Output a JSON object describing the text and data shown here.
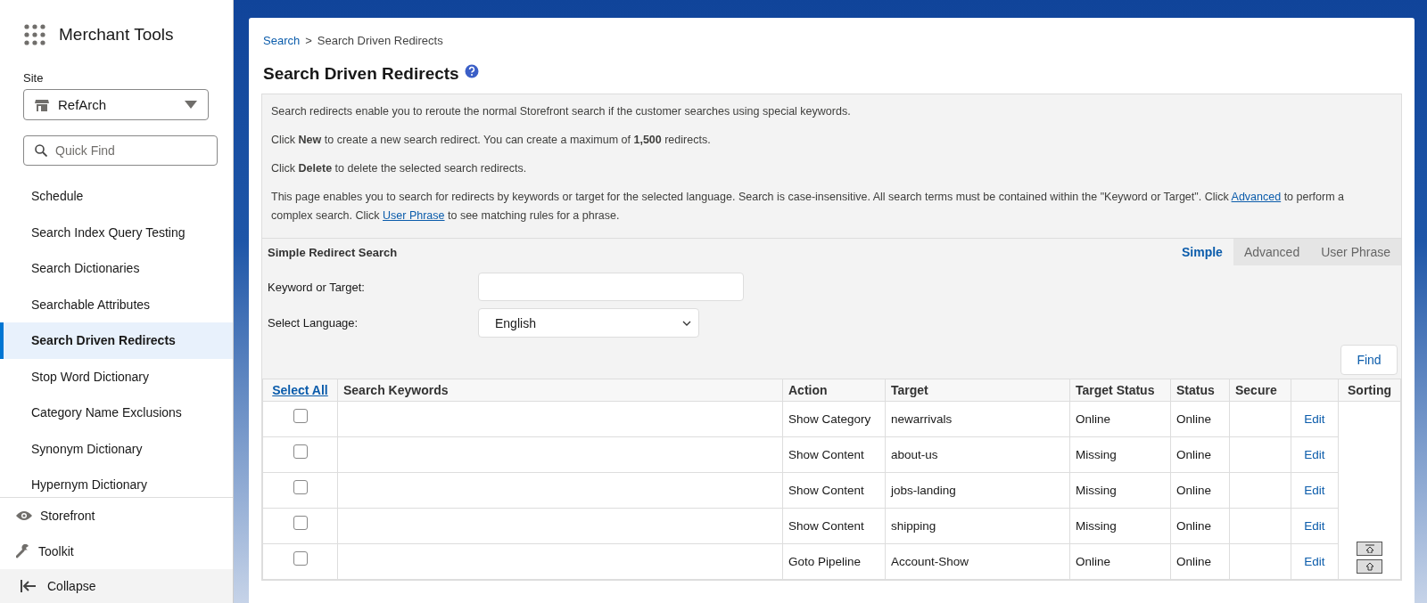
{
  "sidebar": {
    "app_title": "Merchant Tools",
    "site_label": "Site",
    "site_select": {
      "value": "RefArch"
    },
    "quick_find": {
      "placeholder": "Quick Find"
    },
    "items": [
      {
        "label": "Schedule",
        "selected": false
      },
      {
        "label": "Search Index Query Testing",
        "selected": false
      },
      {
        "label": "Search Dictionaries",
        "selected": false
      },
      {
        "label": "Searchable Attributes",
        "selected": false
      },
      {
        "label": "Search Driven Redirects",
        "selected": true
      },
      {
        "label": "Stop Word Dictionary",
        "selected": false
      },
      {
        "label": "Category Name Exclusions",
        "selected": false
      },
      {
        "label": "Synonym Dictionary",
        "selected": false
      },
      {
        "label": "Hypernym Dictionary",
        "selected": false
      }
    ],
    "footer_items": [
      {
        "label": "Storefront",
        "kind": "eye"
      },
      {
        "label": "Toolkit",
        "kind": "wrench"
      },
      {
        "label": "Collapse",
        "kind": "collapse"
      }
    ]
  },
  "breadcrumb": {
    "separator": ">",
    "items": [
      {
        "label": "Search",
        "kind": "link"
      },
      {
        "label": "Search Driven Redirects",
        "kind": "current"
      }
    ]
  },
  "title": "Search Driven Redirects",
  "info": [
    [
      {
        "kind": "text",
        "text": "Search redirects enable you to reroute the normal Storefront search if the customer searches using special keywords."
      }
    ],
    [
      {
        "kind": "text",
        "text": "Click **New** to create a new search redirect. You can create a maximum of **1,500** redirects."
      }
    ],
    [
      {
        "kind": "text",
        "text": "Click **Delete** to delete the selected search redirects."
      }
    ],
    [
      {
        "kind": "text",
        "text": "This page enables you to search for redirects by keywords or target for the selected language. Search is case-insensitive. All search terms must be contained within the \"Keyword or Target\". Click "
      },
      {
        "kind": "link",
        "text": "Advanced"
      },
      {
        "kind": "text",
        "text": " to perform a complex search. Click "
      },
      {
        "kind": "link",
        "text": "User Phrase"
      },
      {
        "kind": "text",
        "text": " to see matching rules for a phrase."
      }
    ]
  ],
  "search": {
    "title": "Simple Redirect Search",
    "tabs": [
      {
        "label": "Simple",
        "selected": true
      },
      {
        "label": "Advanced",
        "selected": false
      },
      {
        "label": "User Phrase",
        "selected": false
      }
    ],
    "fields": [
      {
        "label": "Keyword or Target:",
        "kind": "text"
      },
      {
        "label": "Select Language:",
        "kind": "select",
        "value": "English"
      }
    ],
    "find_button": "Find"
  },
  "table": {
    "columns": [
      {
        "label": "Select All",
        "kind": "link"
      },
      {
        "label": "Search Keywords",
        "kind": "text"
      },
      {
        "label": "Action",
        "kind": "text"
      },
      {
        "label": "Target",
        "kind": "text"
      },
      {
        "label": "Target Status",
        "kind": "text"
      },
      {
        "label": "Status",
        "kind": "text"
      },
      {
        "label": "Secure",
        "kind": "text"
      },
      {
        "kind": "blank"
      },
      {
        "label": "Sorting",
        "kind": "text"
      }
    ],
    "rows": [
      {
        "checked": false,
        "action": "Show Category",
        "target": "newarrivals",
        "target_status": "Online",
        "status": "Online",
        "edit": "Edit"
      },
      {
        "checked": false,
        "action": "Show Content",
        "target": "about-us",
        "target_status": "Missing",
        "status": "Online",
        "edit": "Edit"
      },
      {
        "checked": false,
        "action": "Show Content",
        "target": "jobs-landing",
        "target_status": "Missing",
        "status": "Online",
        "edit": "Edit"
      },
      {
        "checked": false,
        "action": "Show Content",
        "target": "shipping",
        "target_status": "Missing",
        "status": "Online",
        "edit": "Edit"
      },
      {
        "checked": false,
        "action": "Goto Pipeline",
        "target": "Account-Show",
        "target_status": "Online",
        "status": "Online",
        "edit": "Edit"
      }
    ]
  }
}
